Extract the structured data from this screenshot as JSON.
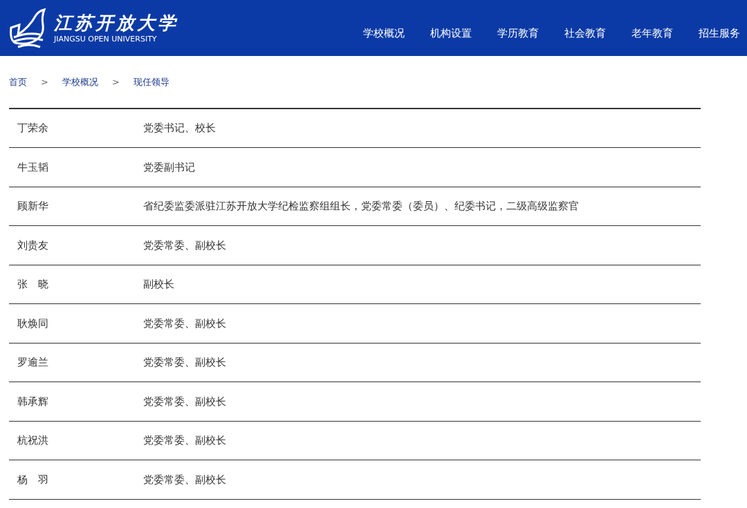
{
  "header": {
    "logo_cn": "江苏开放大学",
    "logo_en": "JIANGSU OPEN UNIVERSITY",
    "nav": [
      {
        "label": "学校概况"
      },
      {
        "label": "机构设置"
      },
      {
        "label": "学历教育"
      },
      {
        "label": "社会教育"
      },
      {
        "label": "老年教育"
      },
      {
        "label": "招生服务"
      }
    ]
  },
  "breadcrumb": {
    "items": [
      "首页",
      "学校概况",
      "现任领导"
    ],
    "separator": ">"
  },
  "table": {
    "rows": [
      {
        "name": "丁荣余",
        "position": "党委书记、校长"
      },
      {
        "name": "牛玉韬",
        "position": "党委副书记"
      },
      {
        "name": "顾新华",
        "position": "省纪委监委派驻江苏开放大学纪检监察组组长，党委常委（委员）、纪委书记，二级高级监察官"
      },
      {
        "name": "刘贵友",
        "position": "党委常委、副校长"
      },
      {
        "name": "张　晓",
        "position": "副校长"
      },
      {
        "name": "耿焕同",
        "position": "党委常委、副校长"
      },
      {
        "name": "罗逾兰",
        "position": "党委常委、副校长"
      },
      {
        "name": "韩承辉",
        "position": "党委常委、副校长"
      },
      {
        "name": "杭祝洪",
        "position": "党委常委、副校长"
      },
      {
        "name": "杨　羽",
        "position": "党委常委、副校长"
      }
    ]
  }
}
